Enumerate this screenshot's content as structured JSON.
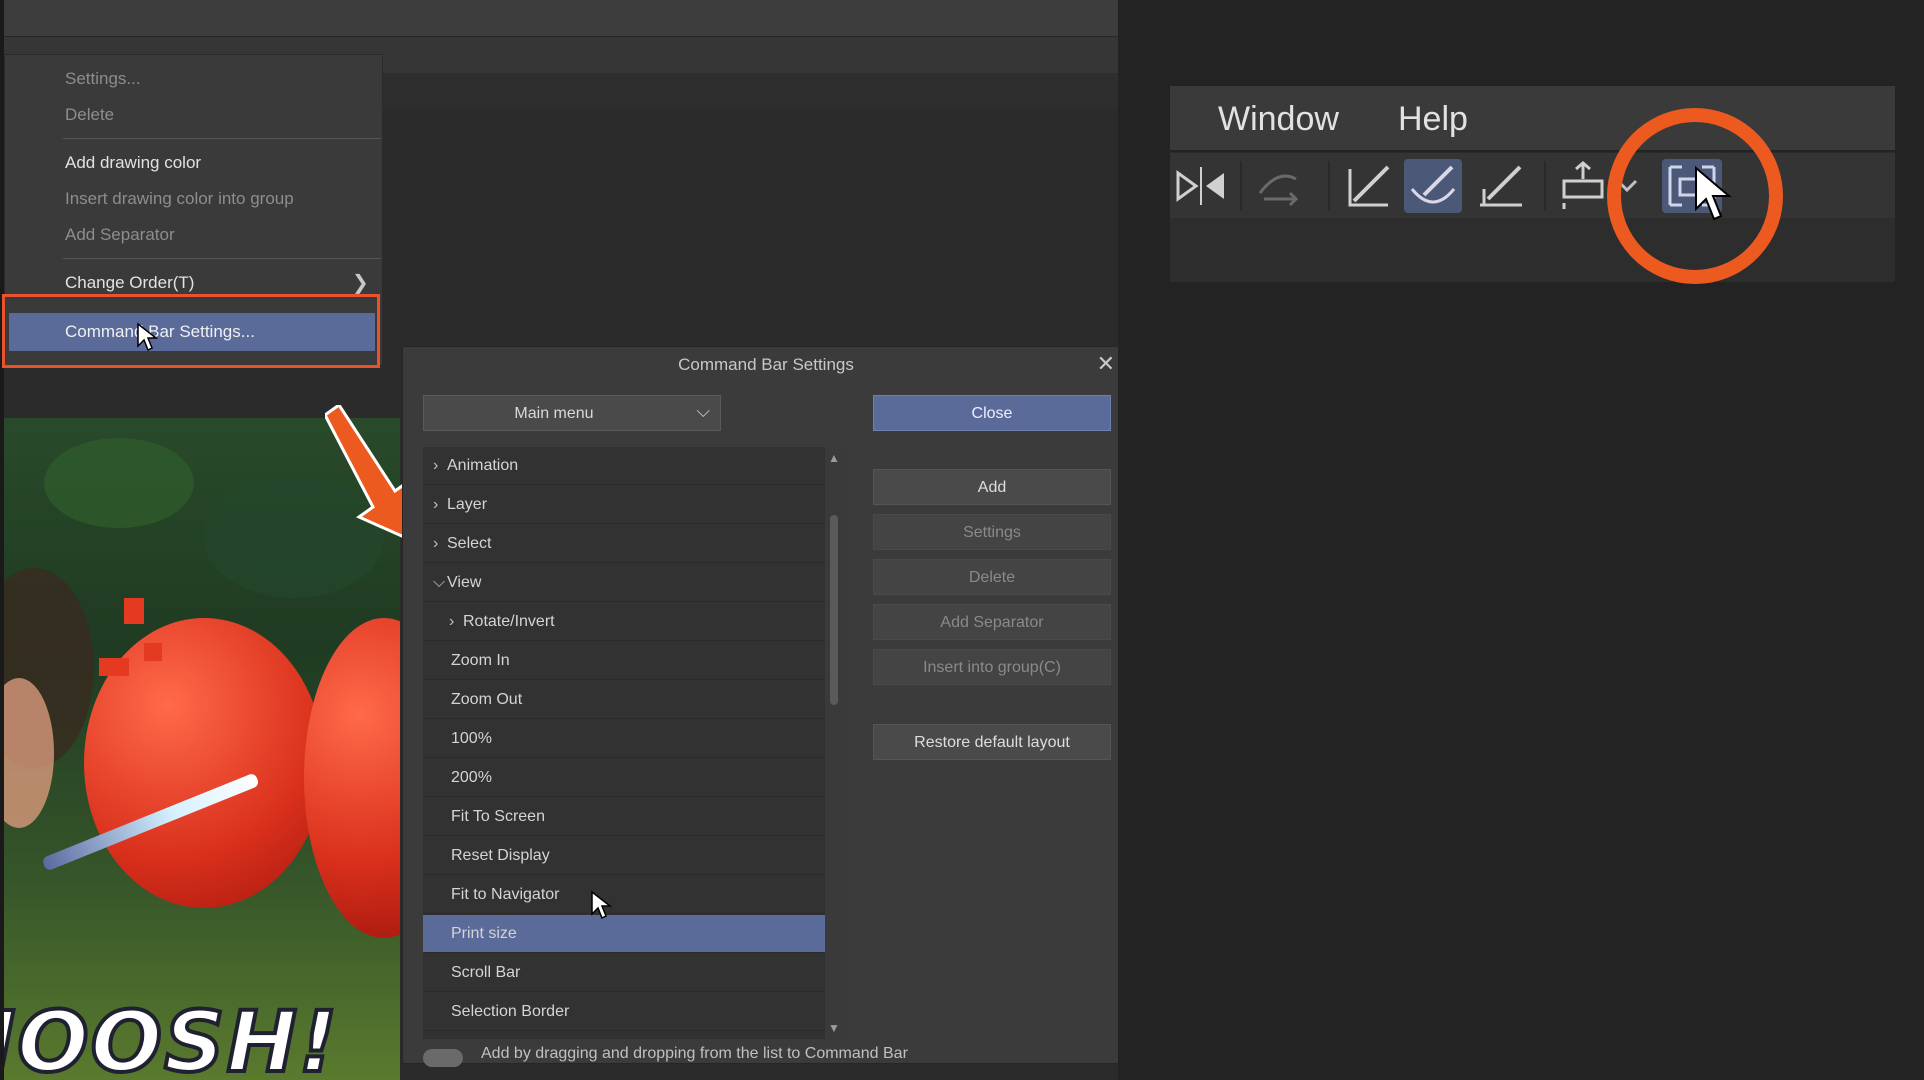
{
  "context_menu": {
    "items": [
      {
        "label": "Settings...",
        "enabled": false
      },
      {
        "label": "Delete",
        "enabled": false
      },
      {
        "label": "Add drawing color",
        "enabled": true
      },
      {
        "label": "Insert drawing color into group",
        "enabled": false
      },
      {
        "label": "Add Separator",
        "enabled": false
      },
      {
        "label": "Change Order(T)",
        "enabled": true,
        "has_submenu": true
      },
      {
        "label": "Command Bar Settings...",
        "enabled": true,
        "highlighted": true
      }
    ]
  },
  "artwork": {
    "caption": "JOOSH!"
  },
  "dialog": {
    "title": "Command Bar Settings",
    "dropdown_value": "Main menu",
    "list": [
      {
        "label": "Animation",
        "expander": ">",
        "level": 0
      },
      {
        "label": "Layer",
        "expander": ">",
        "level": 0
      },
      {
        "label": "Select",
        "expander": ">",
        "level": 0
      },
      {
        "label": "View",
        "expander": "v",
        "level": 0
      },
      {
        "label": "Rotate/Invert",
        "expander": ">",
        "level": 1
      },
      {
        "label": "Zoom In",
        "expander": "",
        "level": 1
      },
      {
        "label": "Zoom Out",
        "expander": "",
        "level": 1
      },
      {
        "label": "100%",
        "expander": "",
        "level": 1
      },
      {
        "label": "200%",
        "expander": "",
        "level": 1
      },
      {
        "label": "Fit To Screen",
        "expander": "",
        "level": 1
      },
      {
        "label": "Reset Display",
        "expander": "",
        "level": 1
      },
      {
        "label": "Fit to Navigator",
        "expander": "",
        "level": 1
      },
      {
        "label": "Print size",
        "expander": "",
        "level": 1,
        "selected": true
      },
      {
        "label": "Scroll Bar",
        "expander": "",
        "level": 1
      },
      {
        "label": "Selection Border",
        "expander": "",
        "level": 1
      }
    ],
    "buttons": {
      "close": "Close",
      "add": "Add",
      "settings": "Settings",
      "delete": "Delete",
      "add_separator": "Add Separator",
      "insert_group": "Insert into group(C)",
      "restore": "Restore default layout"
    },
    "hint": "Add by dragging and dropping from the list to Command Bar"
  },
  "zoom_panel": {
    "menubar": [
      "Window",
      "Help"
    ],
    "toolbar_icons": [
      "flip-horizontal-icon",
      "swap-color-icon",
      "pen-line-icon",
      "brush-active-icon",
      "ruler-pen-icon",
      "transform-icon",
      "dropdown-chevron-icon",
      "print-size-icon"
    ]
  },
  "colors": {
    "accent_blue": "#5a6a99",
    "highlight_orange": "#e9522a"
  }
}
